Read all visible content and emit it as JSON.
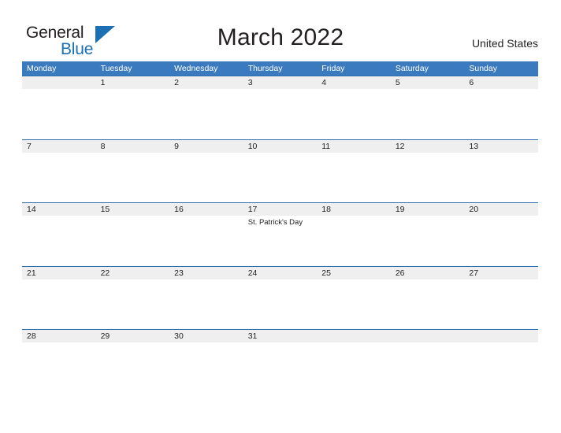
{
  "branding": {
    "name_part1": "General",
    "name_part2": "Blue",
    "logo_icon": "triangle-icon",
    "accent_color": "#1a6fb5"
  },
  "header": {
    "title": "March 2022",
    "region": "United States"
  },
  "calendar": {
    "header_color": "#3c7ac0",
    "band_color": "#efefef",
    "rule_color": "#2f6ead",
    "weekday_headers": [
      "Monday",
      "Tuesday",
      "Wednesday",
      "Thursday",
      "Friday",
      "Saturday",
      "Sunday"
    ],
    "weeks": [
      [
        {
          "day": "",
          "event": ""
        },
        {
          "day": "1",
          "event": ""
        },
        {
          "day": "2",
          "event": ""
        },
        {
          "day": "3",
          "event": ""
        },
        {
          "day": "4",
          "event": ""
        },
        {
          "day": "5",
          "event": ""
        },
        {
          "day": "6",
          "event": ""
        }
      ],
      [
        {
          "day": "7",
          "event": ""
        },
        {
          "day": "8",
          "event": ""
        },
        {
          "day": "9",
          "event": ""
        },
        {
          "day": "10",
          "event": ""
        },
        {
          "day": "11",
          "event": ""
        },
        {
          "day": "12",
          "event": ""
        },
        {
          "day": "13",
          "event": ""
        }
      ],
      [
        {
          "day": "14",
          "event": ""
        },
        {
          "day": "15",
          "event": ""
        },
        {
          "day": "16",
          "event": ""
        },
        {
          "day": "17",
          "event": "St. Patrick's Day"
        },
        {
          "day": "18",
          "event": ""
        },
        {
          "day": "19",
          "event": ""
        },
        {
          "day": "20",
          "event": ""
        }
      ],
      [
        {
          "day": "21",
          "event": ""
        },
        {
          "day": "22",
          "event": ""
        },
        {
          "day": "23",
          "event": ""
        },
        {
          "day": "24",
          "event": ""
        },
        {
          "day": "25",
          "event": ""
        },
        {
          "day": "26",
          "event": ""
        },
        {
          "day": "27",
          "event": ""
        }
      ],
      [
        {
          "day": "28",
          "event": ""
        },
        {
          "day": "29",
          "event": ""
        },
        {
          "day": "30",
          "event": ""
        },
        {
          "day": "31",
          "event": ""
        },
        {
          "day": "",
          "event": ""
        },
        {
          "day": "",
          "event": ""
        },
        {
          "day": "",
          "event": ""
        }
      ]
    ]
  }
}
